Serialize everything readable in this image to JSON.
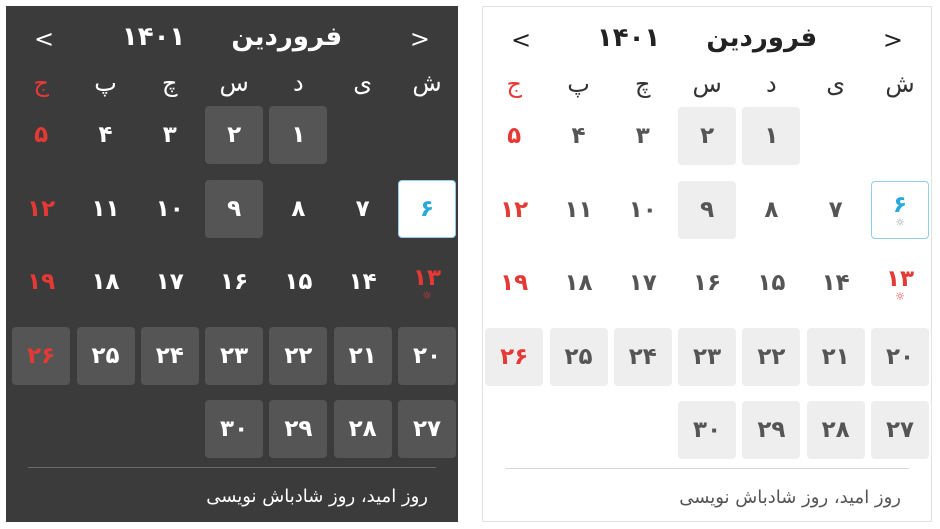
{
  "calendar": {
    "month": "فروردین",
    "year": "۱۴۰۱",
    "prev_label": "<",
    "next_label": ">",
    "weekdays": [
      "ش",
      "ی",
      "د",
      "س",
      "چ",
      "پ",
      "ج"
    ],
    "weeks": [
      [
        {
          "d": "",
          "t": ""
        },
        {
          "d": "",
          "t": ""
        },
        {
          "d": "۱",
          "t": "boxed"
        },
        {
          "d": "۲",
          "t": "boxed"
        },
        {
          "d": "۳",
          "t": ""
        },
        {
          "d": "۴",
          "t": ""
        },
        {
          "d": "۵",
          "t": "holiday"
        }
      ],
      [
        {
          "d": "۶",
          "t": "today"
        },
        {
          "d": "۷",
          "t": ""
        },
        {
          "d": "۸",
          "t": ""
        },
        {
          "d": "۹",
          "t": "boxed"
        },
        {
          "d": "۱۰",
          "t": ""
        },
        {
          "d": "۱۱",
          "t": ""
        },
        {
          "d": "۱۲",
          "t": "holiday"
        }
      ],
      [
        {
          "d": "۱۳",
          "t": "holiday-event"
        },
        {
          "d": "۱۴",
          "t": ""
        },
        {
          "d": "۱۵",
          "t": ""
        },
        {
          "d": "۱۶",
          "t": ""
        },
        {
          "d": "۱۷",
          "t": ""
        },
        {
          "d": "۱۸",
          "t": ""
        },
        {
          "d": "۱۹",
          "t": "holiday"
        }
      ],
      [
        {
          "d": "۲۰",
          "t": "boxed"
        },
        {
          "d": "۲۱",
          "t": "boxed"
        },
        {
          "d": "۲۲",
          "t": "boxed"
        },
        {
          "d": "۲۳",
          "t": "boxed"
        },
        {
          "d": "۲۴",
          "t": "boxed"
        },
        {
          "d": "۲۵",
          "t": "boxed"
        },
        {
          "d": "۲۶",
          "t": "boxed holiday"
        }
      ],
      [
        {
          "d": "۲۷",
          "t": "boxed"
        },
        {
          "d": "۲۸",
          "t": "boxed"
        },
        {
          "d": "۲۹",
          "t": "boxed"
        },
        {
          "d": "۳۰",
          "t": "boxed"
        },
        {
          "d": "",
          "t": ""
        },
        {
          "d": "",
          "t": ""
        },
        {
          "d": "",
          "t": ""
        }
      ]
    ],
    "event_text": "روز امید، روز شادباش نویسی",
    "event_marker": "☼",
    "colors": {
      "holiday": "#e53935",
      "today": "#29a8e0",
      "dark_bg": "#3b3b3b",
      "cell_dark": "#555555",
      "cell_light": "#eeeeee"
    }
  }
}
